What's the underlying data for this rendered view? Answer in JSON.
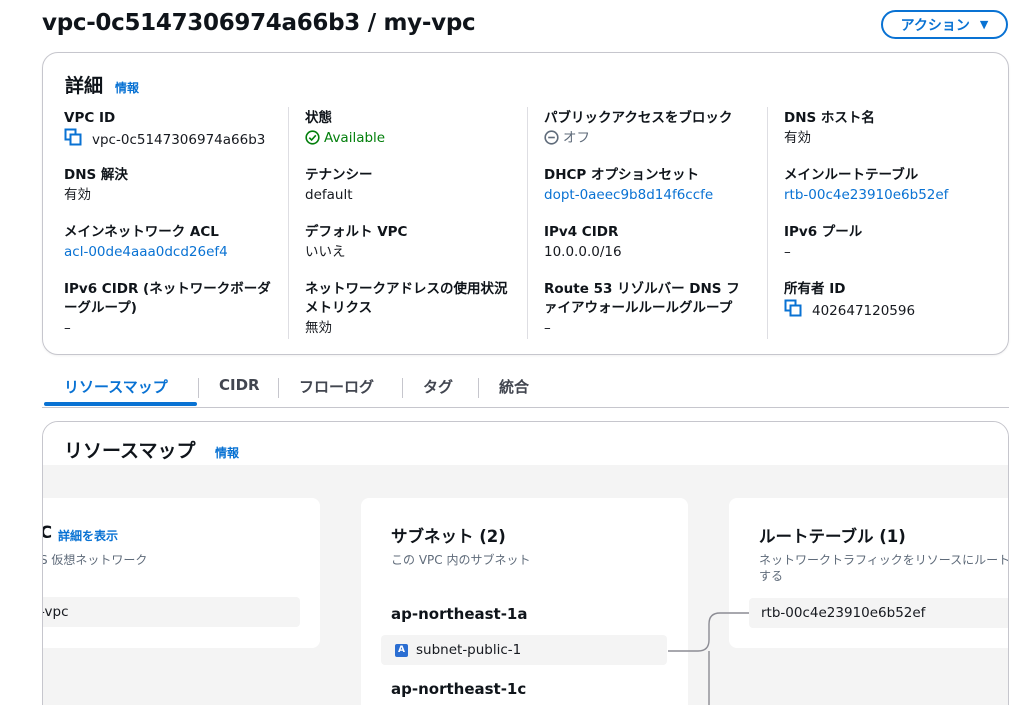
{
  "header": {
    "title": "vpc-0c5147306974a66b3 / my-vpc",
    "action_label": "アクション"
  },
  "details": {
    "heading": "詳細",
    "info": "情報",
    "columns": [
      [
        {
          "label": "VPC ID",
          "value": "vpc-0c5147306974a66b3"
        },
        {
          "label": "DNS 解決",
          "value": "有効"
        },
        {
          "label": "メインネットワーク ACL",
          "value": "acl-00de4aaa0dcd26ef4"
        },
        {
          "label": "IPv6 CIDR (ネットワークボーダーグループ)",
          "value": "–"
        }
      ],
      [
        {
          "label": "状態",
          "value": "Available"
        },
        {
          "label": "テナンシー",
          "value": "default"
        },
        {
          "label": "デフォルト VPC",
          "value": "いいえ"
        },
        {
          "label": "ネットワークアドレスの使用状況メトリクス",
          "value": "無効"
        }
      ],
      [
        {
          "label": "パブリックアクセスをブロック",
          "value": "オフ"
        },
        {
          "label": "DHCP オプションセット",
          "value": "dopt-0aeec9b8d14f6ccfe"
        },
        {
          "label": "IPv4 CIDR",
          "value": "10.0.0.0/16"
        },
        {
          "label": "Route 53 リゾルバー DNS ファイアウォールルールグループ",
          "value": "–"
        }
      ],
      [
        {
          "label": "DNS ホスト名",
          "value": "有効"
        },
        {
          "label": "メインルートテーブル",
          "value": "rtb-00c4e23910e6b52ef"
        },
        {
          "label": "IPv6 プール",
          "value": "–"
        },
        {
          "label": "所有者 ID",
          "value": "402647120596"
        }
      ]
    ]
  },
  "tabs": [
    "リソースマップ",
    "CIDR",
    "フローログ",
    "タグ",
    "統合"
  ],
  "resource_map": {
    "heading": "リソースマップ",
    "info": "情報",
    "vpc_card": {
      "title_fragment": "C",
      "details_link": "詳細を表示",
      "desc_fragment": "S 仮想ネットワーク",
      "item_fragment": "-vpc"
    },
    "subnets": {
      "title": "サブネット (2)",
      "desc": "この VPC 内のサブネット",
      "az1": "ap-northeast-1a",
      "az1_subnet": "subnet-public-1",
      "az1_badge": "A",
      "az2": "ap-northeast-1c"
    },
    "route_tables": {
      "title": "ルートテーブル (1)",
      "desc": "ネットワークトラフィックをリソースにルートする",
      "item": "rtb-00c4e23910e6b52ef"
    }
  },
  "colors": {
    "accent": "#0972d3",
    "available_green": "#037f0c",
    "text": "#16191f",
    "muted": "#5f6b7a"
  }
}
